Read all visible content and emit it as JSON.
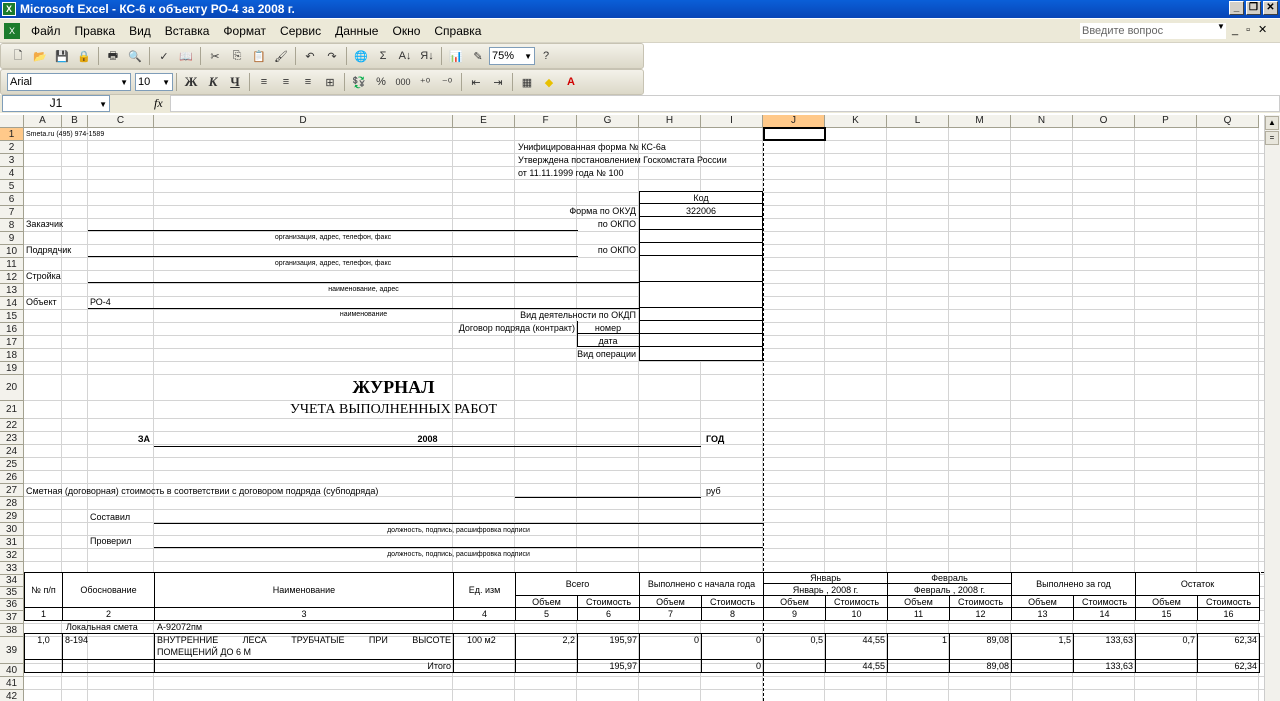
{
  "window": {
    "title": "Microsoft Excel - КС-6 к объекту РО-4 за 2008 г."
  },
  "menu": [
    "Файл",
    "Правка",
    "Вид",
    "Вставка",
    "Формат",
    "Сервис",
    "Данные",
    "Окно",
    "Справка"
  ],
  "help_placeholder": "Введите вопрос",
  "toolbar": {
    "zoom": "75%",
    "font": "Arial",
    "size": "10",
    "bold": "Ж",
    "italic": "К",
    "underline": "Ч",
    "percent": "%",
    "thousands": "000",
    "sigma": "Σ"
  },
  "namebox": "J1",
  "fx": "fx",
  "columns": [
    "A",
    "B",
    "C",
    "D",
    "E",
    "F",
    "G",
    "H",
    "I",
    "J",
    "K",
    "L",
    "M",
    "N",
    "O",
    "P",
    "Q"
  ],
  "sheet": {
    "r1": "Smeta.ru  (495) 974-1589",
    "form1": "Унифицированная форма № КС-6а",
    "form2": "Утверждена постановлением Госкомстата России",
    "form3": "от 11.11.1999 года № 100",
    "code": "Код",
    "okud_label": "Форма по ОКУД",
    "okud": "322006",
    "customer": "Заказчик",
    "okpo": "по ОКПО",
    "org_hint": "организация, адрес, телефон, факс",
    "contractor": "Подрядчик",
    "okpo2": "по ОКПО",
    "org_hint2": "организация, адрес, телефон, факс",
    "site": "Стройка",
    "site_hint": "наименование, адрес",
    "object": "Объект",
    "object_val": "РО-4",
    "object_hint": "наименование",
    "okdp": "Вид деятельности по ОКДП",
    "contract": "Договор подряда (контракт)",
    "number": "номер",
    "date": "дата",
    "operation": "Вид операции",
    "journal": "ЖУРНАЛ",
    "journal_sub": "УЧЕТА ВЫПОЛНЕННЫХ РАБОТ",
    "za": "ЗА",
    "year": "2008",
    "god": "ГОД",
    "cost_line": "Сметная (договорная) стоимость в соответствии с договором подряда (субподряда)",
    "rub": "руб",
    "composed": "Составил",
    "sign_hint": "должность, подпись, расшифровка подписи",
    "checked": "Проверил",
    "sign_hint2": "должность, подпись, расшифровка подписи",
    "h_num": "№ п/п",
    "h_basis": "Обоснование",
    "h_name": "Наименование",
    "h_unit": "Ед. изм",
    "h_total": "Всего",
    "h_done": "Выполнено с начала года",
    "h_jan": "Январь",
    "h_jan2": "Январь , 2008 г.",
    "h_feb": "Февраль",
    "h_feb2": "Февраль , 2008 г.",
    "h_year": "Выполнено за год",
    "h_rest": "Остаток",
    "vol": "Объем",
    "cost": "Стоимость",
    "nums": [
      "1",
      "2",
      "3",
      "4",
      "5",
      "6",
      "7",
      "8",
      "9",
      "10",
      "11",
      "12",
      "13",
      "14",
      "15",
      "16"
    ],
    "local_est": "Локальная смета",
    "est_code": "А-92072пм",
    "row": {
      "n": "1,0",
      "basis": "8-194",
      "name1": "ВНУТРЕННИЕ    ЛЕСА    ТРУБЧАТЫЕ    ПРИ    ВЫСОТЕ",
      "name2": "ПОМЕЩЕНИЙ ДО 6 М",
      "unit": "100 м2",
      "f": "2,2",
      "g": "195,97",
      "h": "0",
      "i": "0",
      "j": "0,5",
      "k": "44,55",
      "l": "1",
      "m": "89,08",
      "n2": "1,5",
      "o": "133,63",
      "p": "0,7",
      "q": "62,34"
    },
    "itogo": "Итого",
    "tot": {
      "g": "195,97",
      "i": "0",
      "k": "44,55",
      "m": "89,08",
      "o": "133,63",
      "q": "62,34"
    }
  }
}
